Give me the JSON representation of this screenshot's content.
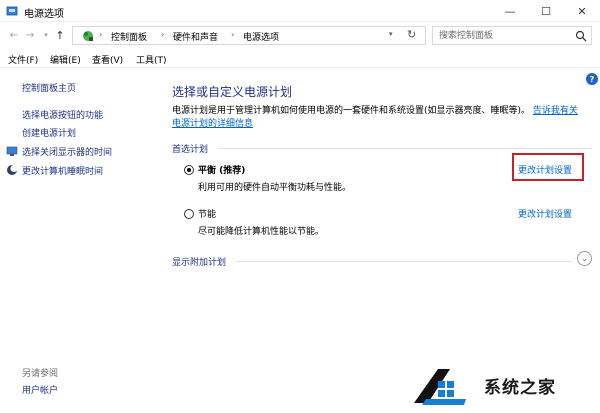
{
  "window": {
    "title": "电源选项",
    "controls": {
      "minimize": "—",
      "maximize": "☐",
      "close": "✕"
    }
  },
  "address": {
    "breadcrumbs": [
      "控制面板",
      "硬件和声音",
      "电源选项"
    ],
    "search_placeholder": "搜索控制面板"
  },
  "menu": [
    "文件(F)",
    "编辑(E)",
    "查看(V)",
    "工具(T)"
  ],
  "sidebar": {
    "home": "控制面板主页",
    "links": [
      "选择电源按钮的功能",
      "创建电源计划",
      "选择关闭显示器的时间",
      "更改计算机睡眠时间"
    ],
    "see_also": "另请参阅",
    "user_accounts": "用户帐户"
  },
  "main": {
    "title": "选择或自定义电源计划",
    "description": "电源计划是用于管理计算机如何使用电源的一套硬件和系统设置(如显示器亮度、睡眠等)。",
    "description_link": "告诉我有关电源计划的详细信息",
    "description_link_line1": "告诉我有关",
    "description_link_line2": "电源计划的详细信息",
    "preferred_section": "首选计划",
    "plans": [
      {
        "name": "平衡 (推荐)",
        "desc": "利用可用的硬件自动平衡功耗与性能。",
        "link": "更改计划设置",
        "selected": true
      },
      {
        "name": "节能",
        "desc": "尽可能降低计算机性能以节能。",
        "link": "更改计划设置",
        "selected": false
      }
    ],
    "more_section": "显示附加计划",
    "help": "?"
  },
  "watermark": {
    "text": "系统之家"
  },
  "colors": {
    "link": "#0066cc",
    "heading": "#1e3287",
    "highlight": "#c8202b"
  }
}
